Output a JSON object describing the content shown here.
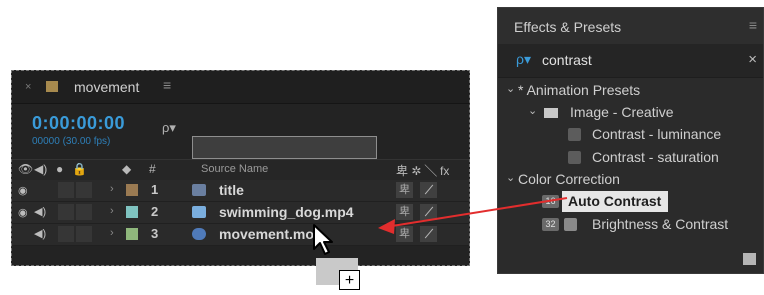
{
  "timeline": {
    "tab": {
      "title": "movement",
      "menu": "≡",
      "close": "×"
    },
    "timecode": "0:00:00:00",
    "fps": "00000 (30.00 fps)",
    "search_icon": "ρ▾",
    "header": {
      "source_name": "Source Name",
      "hash": "#"
    },
    "layers": [
      {
        "num": "1",
        "name": "title",
        "label_color": "#9a7a52",
        "type_color": "#6a7fa0"
      },
      {
        "num": "2",
        "name": "swimming_dog.mp4",
        "label_color": "#7fc3c0",
        "type_color": "#7aaede"
      },
      {
        "num": "3",
        "name": "movement.mo",
        "label_color": "#8fb77c",
        "type_color": "#4f7ab9"
      }
    ],
    "switch_icon": "卑"
  },
  "effects": {
    "title": "Effects & Presets",
    "menu": "≡",
    "search_value": "contrast",
    "search_icon": "ρ▾",
    "clear": "×",
    "items": {
      "animation_presets": "* Animation Presets",
      "image_creative": "Image - Creative",
      "contrast_luminance": "Contrast - luminance",
      "contrast_saturation": "Contrast - saturation",
      "color_correction": "Color Correction",
      "auto_contrast": "Auto Contrast",
      "brightness_contrast": "Brightness & Contrast"
    },
    "badge_16": "16",
    "badge_32": "32",
    "arrow_open": "⌄"
  },
  "cursor_plus": "+",
  "colors": {
    "accent": "#3a9bd9",
    "drag_arrow": "#e22d2d"
  }
}
